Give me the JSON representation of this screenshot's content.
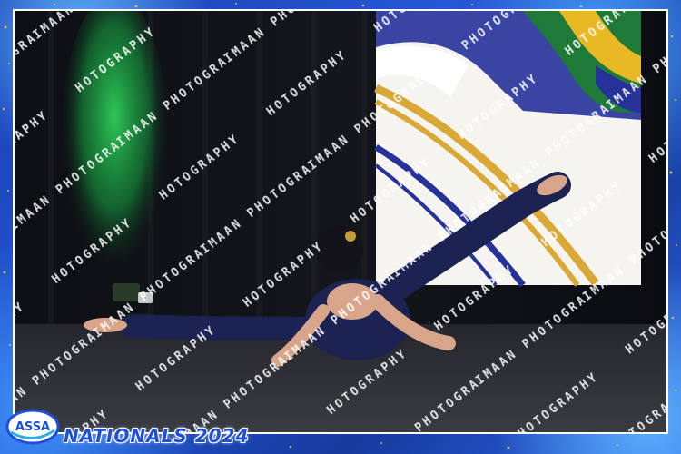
{
  "event": {
    "title": "NATIONALS 2024",
    "logo_text": "ASSA"
  },
  "watermark": {
    "text": "IMAAN PHOTOGRAPHY"
  },
  "colors": {
    "frame_blue": "#1f4fd8",
    "curtain": "#101018",
    "stage_green_light": "#1fb54a",
    "floor": "#2a2a30",
    "costume_navy": "#1c2252",
    "banner_white": "#f5f4ef",
    "banner_gold": "#d9a836",
    "banner_blue": "#26329a",
    "flag_green": "#1f7a3a",
    "flag_yellow": "#e8b923"
  }
}
